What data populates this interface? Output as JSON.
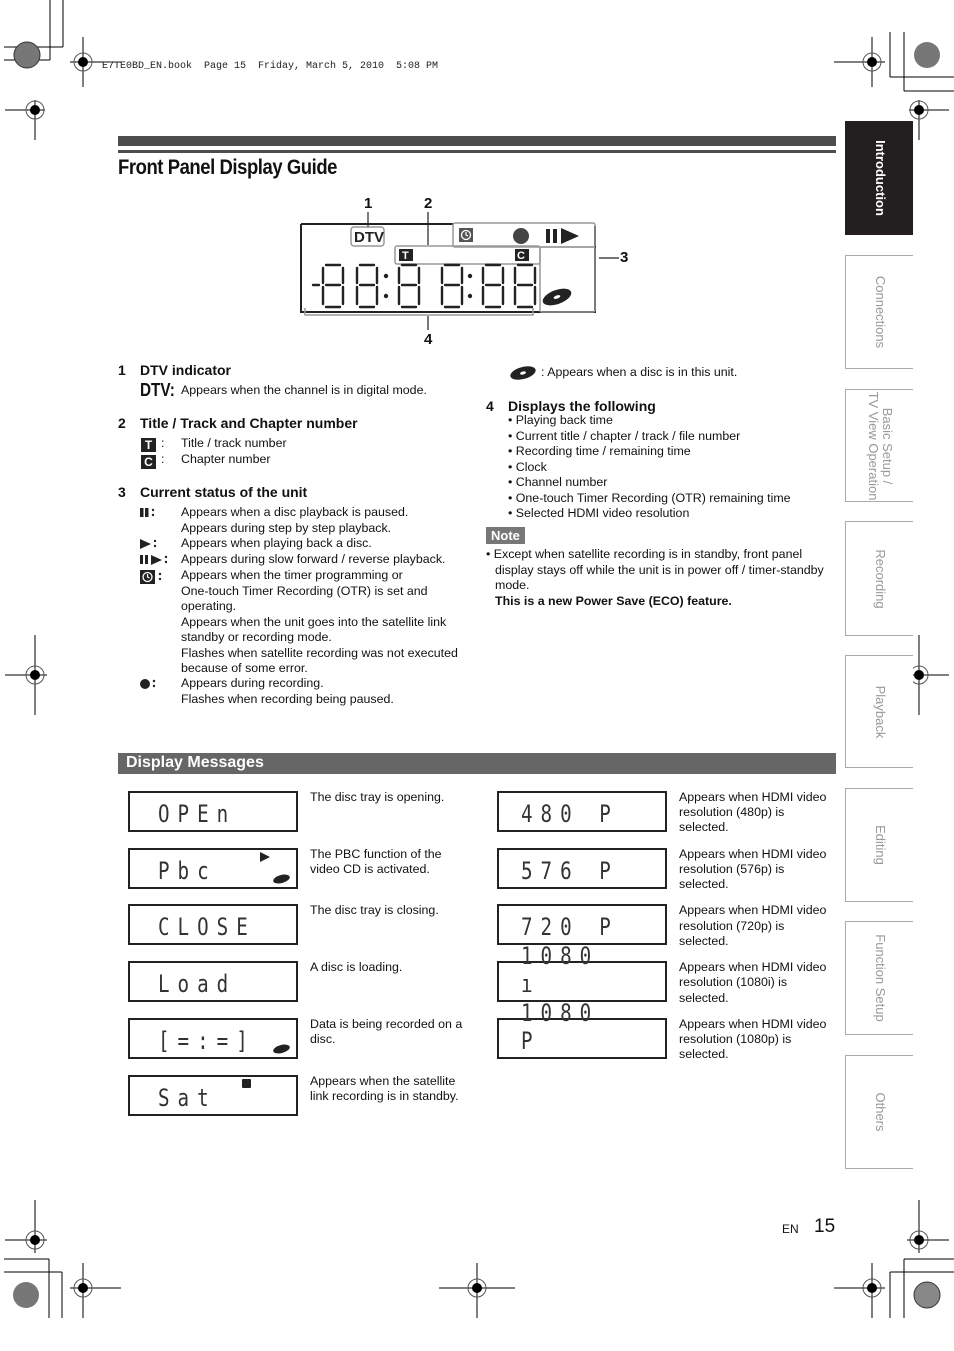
{
  "print_header": "E7TE0BD_EN.book  Page 15  Friday, March 5, 2010  5:08 PM",
  "page_title": "Front Panel Display Guide",
  "side_tabs": [
    {
      "label": "Introduction",
      "active": true
    },
    {
      "label": "Connections",
      "active": false
    },
    {
      "label": "Basic Setup /\nTV View Operation",
      "active": false
    },
    {
      "label": "Recording",
      "active": false
    },
    {
      "label": "Playback",
      "active": false
    },
    {
      "label": "Editing",
      "active": false
    },
    {
      "label": "Function Setup",
      "active": false
    },
    {
      "label": "Others",
      "active": false
    }
  ],
  "diagram": {
    "callouts": [
      "1",
      "2",
      "3",
      "4"
    ],
    "dtv_label": "DTV",
    "title_icon": "T",
    "chapter_icon": "C",
    "digits": "-88:8 8:88"
  },
  "sections": {
    "s1": {
      "num": "1",
      "title": "DTV indicator",
      "icon": "DTV:",
      "text": "Appears when the channel is in digital mode."
    },
    "s2": {
      "num": "2",
      "title": "Title / Track and Chapter number",
      "items": [
        {
          "icon": "T",
          "text": "Title / track number"
        },
        {
          "icon": "C",
          "text": "Chapter number"
        }
      ]
    },
    "s3": {
      "num": "3",
      "title": "Current status of the unit",
      "items": [
        {
          "icon": "pause-icon",
          "text": [
            "Appears when a disc playback is paused.",
            "Appears during step by step playback."
          ]
        },
        {
          "icon": "play-icon",
          "text": [
            "Appears when playing back a disc."
          ]
        },
        {
          "icon": "pause-play-icon",
          "text": [
            "Appears during slow forward / reverse playback."
          ]
        },
        {
          "icon": "clock-icon",
          "text": [
            "Appears when the timer programming or",
            "One-touch Timer Recording (OTR) is set and",
            "operating.",
            "Appears when the unit goes into the satellite link",
            "standby or recording mode.",
            "Flashes when satellite recording was not executed",
            "because of some error."
          ]
        },
        {
          "icon": "record-dot-icon",
          "text": [
            "Appears during recording.",
            "Flashes when recording being paused."
          ]
        }
      ]
    },
    "disc": {
      "icon": "disc-icon",
      "text": "Appears when a disc is in this unit."
    },
    "s4": {
      "num": "4",
      "title": "Displays the following",
      "bullets": [
        "Playing back time",
        "Current title / chapter / track / file number",
        "Recording time / remaining time",
        "Clock",
        "Channel number",
        "One-touch Timer Recording (OTR) remaining time",
        "Selected HDMI video resolution"
      ]
    },
    "note": {
      "label": "Note",
      "lines": [
        "Except when satellite recording is in standby, front panel",
        "display stays off while the unit is in power off / timer-standby",
        "mode."
      ],
      "bold": "This is a new Power Save (ECO) feature."
    }
  },
  "display_messages": {
    "title": "Display Messages",
    "left": [
      {
        "lcd": "OPEn",
        "desc": [
          "The disc tray is opening."
        ]
      },
      {
        "lcd": "Pbc",
        "desc": [
          "The PBC function of the",
          "video CD is activated."
        ],
        "play": true,
        "disc": true
      },
      {
        "lcd": "CLOSE",
        "desc": [
          "The disc tray is closing."
        ]
      },
      {
        "lcd": "Load",
        "desc": [
          "A disc is loading."
        ]
      },
      {
        "lcd": "[=:=]",
        "desc": [
          "Data is being recorded on a",
          "disc."
        ],
        "disc": true
      },
      {
        "lcd": "Sat",
        "desc": [
          "Appears when the satellite",
          "link recording is in standby."
        ],
        "clock": true
      }
    ],
    "right": [
      {
        "lcd": "480  P",
        "desc": [
          "Appears when HDMI video",
          "resolution (480p) is",
          "selected."
        ]
      },
      {
        "lcd": "576  P",
        "desc": [
          "Appears when HDMI video",
          "resolution (576p) is",
          "selected."
        ]
      },
      {
        "lcd": "720  P",
        "desc": [
          "Appears when HDMI video",
          "resolution (720p) is",
          "selected."
        ]
      },
      {
        "lcd": "1080 ı",
        "desc": [
          "Appears when HDMI video",
          "resolution (1080i) is",
          "selected."
        ]
      },
      {
        "lcd": "1080 P",
        "desc": [
          "Appears when HDMI video",
          "resolution (1080p) is",
          "selected."
        ]
      }
    ]
  },
  "footer": {
    "lang": "EN",
    "page": "15"
  }
}
